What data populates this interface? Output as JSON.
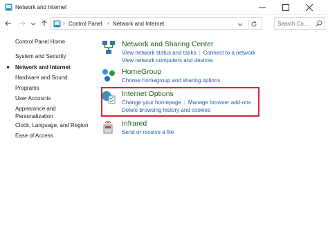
{
  "window": {
    "title": "Network and Internet"
  },
  "address": {
    "crumbs": [
      "Control Panel",
      "Network and Internet"
    ],
    "separator": "›",
    "search_placeholder": "Search Co..."
  },
  "sidebar": {
    "items": [
      {
        "label": "Control Panel Home",
        "active": false
      },
      {
        "label": "System and Security",
        "active": false
      },
      {
        "label": "Network and Internet",
        "active": true
      },
      {
        "label": "Hardware and Sound",
        "active": false
      },
      {
        "label": "Programs",
        "active": false
      },
      {
        "label": "User Accounts",
        "active": false
      },
      {
        "label": "Appearance and",
        "active": false
      },
      {
        "label": "Personalization",
        "active": false
      },
      {
        "label": "Clock, Language, and Region",
        "active": false
      },
      {
        "label": "Ease of Access",
        "active": false
      }
    ]
  },
  "categories": [
    {
      "heading": "Network and Sharing Center",
      "icon": "network-sharing-icon",
      "link_rows": [
        [
          "View network status and tasks",
          "Connect to a network"
        ],
        [
          "View network computers and devices"
        ]
      ]
    },
    {
      "heading": "HomeGroup",
      "icon": "homegroup-icon",
      "link_rows": [
        [
          "Choose homegroup and sharing options"
        ]
      ]
    },
    {
      "heading": "Internet Options",
      "icon": "internet-options-icon",
      "link_rows": [
        [
          "Change your homepage",
          "Manage browser add-ons"
        ],
        [
          "Delete browsing history and cookies"
        ]
      ]
    },
    {
      "heading": "Infrared",
      "icon": "infrared-icon",
      "link_rows": [
        [
          "Send or receive a file"
        ]
      ]
    }
  ],
  "colors": {
    "heading": "#1a5e1a",
    "link": "#1b5fae",
    "highlight_border": "#d6252e"
  }
}
